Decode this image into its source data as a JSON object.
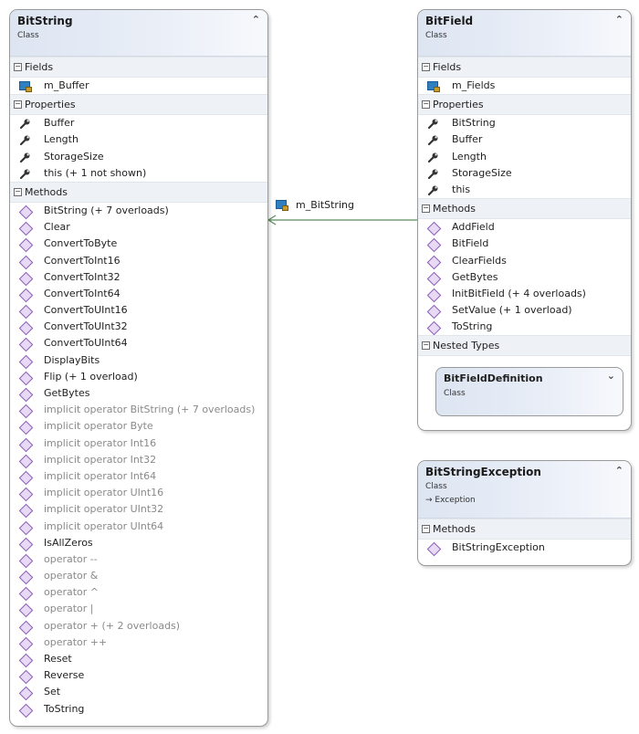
{
  "classes": {
    "bitstring": {
      "title": "BitString",
      "kind": "Class",
      "collapse_glyph": "⌃",
      "fields_label": "Fields",
      "fields": [
        "m_Buffer"
      ],
      "properties_label": "Properties",
      "properties": [
        "Buffer",
        "Length",
        "StorageSize",
        "this (+ 1 not shown)"
      ],
      "methods_label": "Methods",
      "methods": [
        {
          "name": "BitString (+ 7 overloads)",
          "dim": false
        },
        {
          "name": "Clear",
          "dim": false
        },
        {
          "name": "ConvertToByte",
          "dim": false
        },
        {
          "name": "ConvertToInt16",
          "dim": false
        },
        {
          "name": "ConvertToInt32",
          "dim": false
        },
        {
          "name": "ConvertToInt64",
          "dim": false
        },
        {
          "name": "ConvertToUInt16",
          "dim": false
        },
        {
          "name": "ConvertToUInt32",
          "dim": false
        },
        {
          "name": "ConvertToUInt64",
          "dim": false
        },
        {
          "name": "DisplayBits",
          "dim": false
        },
        {
          "name": "Flip (+ 1 overload)",
          "dim": false
        },
        {
          "name": "GetBytes",
          "dim": false
        },
        {
          "name": "implicit operator BitString (+ 7 overloads)",
          "dim": true
        },
        {
          "name": "implicit operator Byte",
          "dim": true
        },
        {
          "name": "implicit operator Int16",
          "dim": true
        },
        {
          "name": "implicit operator Int32",
          "dim": true
        },
        {
          "name": "implicit operator Int64",
          "dim": true
        },
        {
          "name": "implicit operator UInt16",
          "dim": true
        },
        {
          "name": "implicit operator UInt32",
          "dim": true
        },
        {
          "name": "implicit operator UInt64",
          "dim": true
        },
        {
          "name": "IsAllZeros",
          "dim": false
        },
        {
          "name": "operator --",
          "dim": true
        },
        {
          "name": "operator &",
          "dim": true
        },
        {
          "name": "operator ^",
          "dim": true
        },
        {
          "name": "operator |",
          "dim": true
        },
        {
          "name": "operator + (+ 2 overloads)",
          "dim": true
        },
        {
          "name": "operator ++",
          "dim": true
        },
        {
          "name": "Reset",
          "dim": false
        },
        {
          "name": "Reverse",
          "dim": false
        },
        {
          "name": "Set",
          "dim": false
        },
        {
          "name": "ToString",
          "dim": false
        }
      ]
    },
    "bitfield": {
      "title": "BitField",
      "kind": "Class",
      "collapse_glyph": "⌃",
      "fields_label": "Fields",
      "fields": [
        "m_Fields"
      ],
      "properties_label": "Properties",
      "properties": [
        "BitString",
        "Buffer",
        "Length",
        "StorageSize",
        "this"
      ],
      "methods_label": "Methods",
      "methods": [
        {
          "name": "AddField",
          "dim": false
        },
        {
          "name": "BitField",
          "dim": false
        },
        {
          "name": "ClearFields",
          "dim": false
        },
        {
          "name": "GetBytes",
          "dim": false
        },
        {
          "name": "InitBitField (+ 4 overloads)",
          "dim": false
        },
        {
          "name": "SetValue (+ 1 overload)",
          "dim": false
        },
        {
          "name": "ToString",
          "dim": false
        }
      ],
      "nested_label": "Nested Types",
      "nested": {
        "title": "BitFieldDefinition",
        "kind": "Class",
        "expand_glyph": "⌄"
      }
    },
    "bitstringexception": {
      "title": "BitStringException",
      "kind": "Class",
      "base": "→ Exception",
      "collapse_glyph": "⌃",
      "methods_label": "Methods",
      "methods": [
        {
          "name": "BitStringException",
          "dim": false
        }
      ]
    }
  },
  "association": {
    "label": "m_BitString",
    "color": "#5a8a5a"
  }
}
